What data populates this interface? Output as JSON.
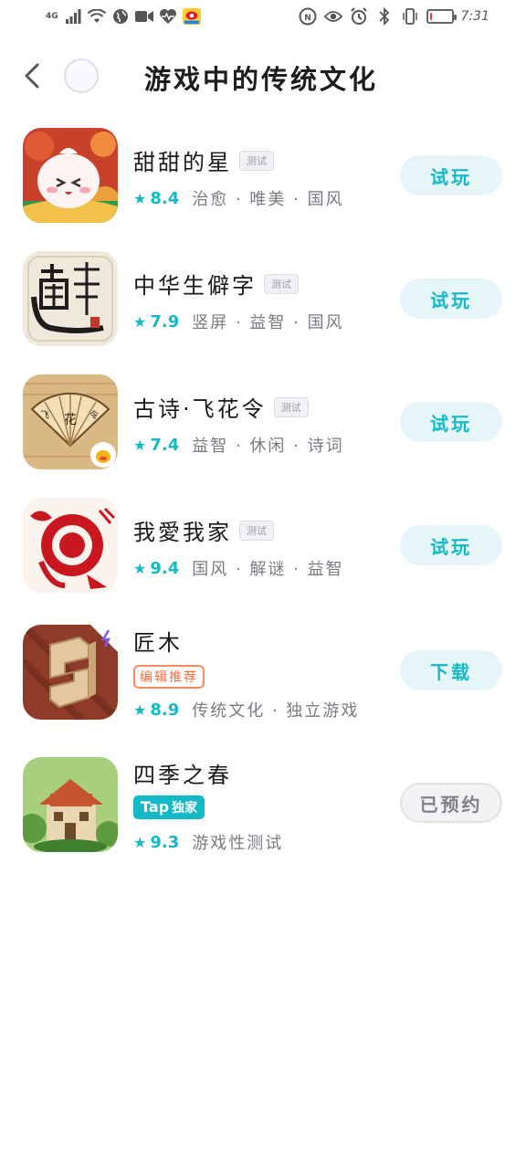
{
  "status_bar": {
    "network": "4G",
    "time": "7:31",
    "battery_level": 0.1
  },
  "header": {
    "title": "游戏中的传统文化"
  },
  "games": [
    {
      "name": "甜甜的星",
      "badge": "测试",
      "score": "8.4",
      "tags": "治愈 · 唯美 · 国风",
      "action": "试玩",
      "icon": "dumpling-game-icon"
    },
    {
      "name": "中华生僻字",
      "badge": "测试",
      "score": "7.9",
      "tags": "竖屏 · 益智 · 国风",
      "action": "试玩",
      "icon": "calligraphy-game-icon"
    },
    {
      "name": "古诗·飞花令",
      "badge": "测试",
      "score": "7.4",
      "tags": "益智 · 休闲 · 诗词",
      "action": "试玩",
      "icon": "fan-poetry-game-icon"
    },
    {
      "name": "我愛我家",
      "badge": "测试",
      "score": "9.4",
      "tags": "国风 · 解谜 · 益智",
      "action": "试玩",
      "icon": "paper-cut-game-icon"
    },
    {
      "name": "匠木",
      "badge": "编辑推荐",
      "score": "8.9",
      "tags": "传统文化 · 独立游戏",
      "action": "下载",
      "icon": "wood-joint-game-icon"
    },
    {
      "name": "四季之春",
      "badge_tap": "Tap",
      "badge_exclusive": "独家",
      "score": "9.3",
      "tags": "游戏性测试",
      "action": "已预约",
      "icon": "house-game-icon"
    }
  ]
}
